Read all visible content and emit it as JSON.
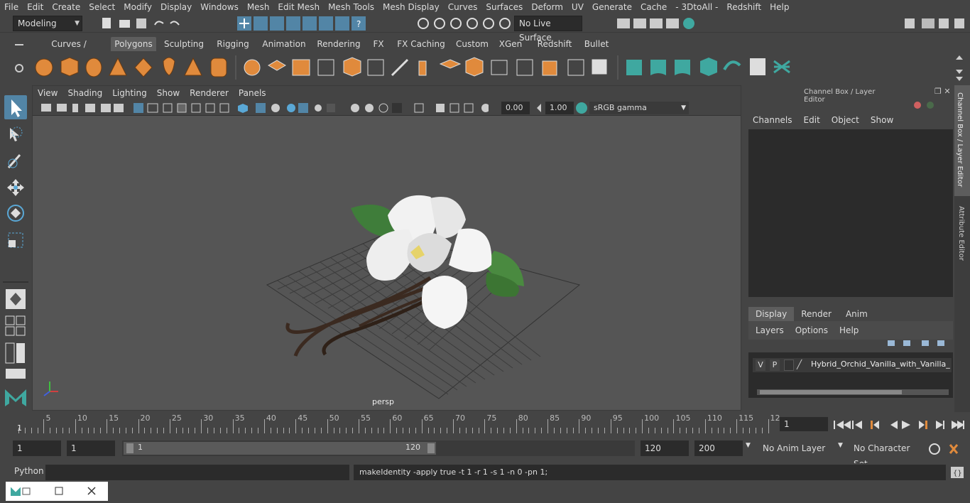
{
  "menubar": {
    "items": [
      "File",
      "Edit",
      "Create",
      "Select",
      "Modify",
      "Display",
      "Windows",
      "Mesh",
      "Edit Mesh",
      "Mesh Tools",
      "Mesh Display",
      "Curves",
      "Surfaces",
      "Deform",
      "UV",
      "Generate",
      "Cache",
      "- 3DtoAll -",
      "Redshift",
      "Help"
    ]
  },
  "status": {
    "mode": "Modeling",
    "live_surface": "No Live Surface"
  },
  "shelf": {
    "tabs": [
      "Curves / Surfaces",
      "Polygons",
      "Sculpting",
      "Rigging",
      "Animation",
      "Rendering",
      "FX",
      "FX Caching",
      "Custom",
      "XGen",
      "Redshift",
      "Bullet"
    ],
    "active": "Polygons"
  },
  "viewport": {
    "menu": [
      "View",
      "Shading",
      "Lighting",
      "Show",
      "Renderer",
      "Panels"
    ],
    "exposure": "0.00",
    "gamma": "1.00",
    "color_space": "sRGB gamma",
    "camera_label": "persp"
  },
  "channelbox": {
    "title": "Channel Box / Layer Editor",
    "menu": [
      "Channels",
      "Edit",
      "Object",
      "Show"
    ],
    "layer_tabs": [
      "Display",
      "Render",
      "Anim"
    ],
    "active_layer_tab": "Display",
    "layer_menu": [
      "Layers",
      "Options",
      "Help"
    ],
    "layer": {
      "v": "V",
      "p": "P",
      "name": "Hybrid_Orchid_Vanilla_with_Vanilla_Sti"
    }
  },
  "sidetabs": {
    "channel": "Channel Box / Layer Editor",
    "attr": "Attribute Editor"
  },
  "timeline": {
    "ticks": [
      "5",
      "10",
      "15",
      "20",
      "25",
      "30",
      "35",
      "40",
      "45",
      "50",
      "55",
      "60",
      "65",
      "70",
      "75",
      "80",
      "85",
      "90",
      "95",
      "100",
      "105",
      "110",
      "115",
      "12"
    ],
    "start_label": "1",
    "current_frame": "1"
  },
  "range": {
    "start": "1",
    "playback_start": "1",
    "slider_start": "1",
    "slider_end": "120",
    "end": "120",
    "anim_end": "200",
    "anim_layer": "No Anim Layer",
    "char_set": "No Character Set"
  },
  "cmd": {
    "lang": "Python",
    "result": "makeIdentity -apply true -t 1 -r 1 -s 1 -n 0 -pn 1;"
  },
  "colors": {
    "accent": "#5285a6",
    "orange": "#e08a3c",
    "teal": "#3fa8a0"
  }
}
